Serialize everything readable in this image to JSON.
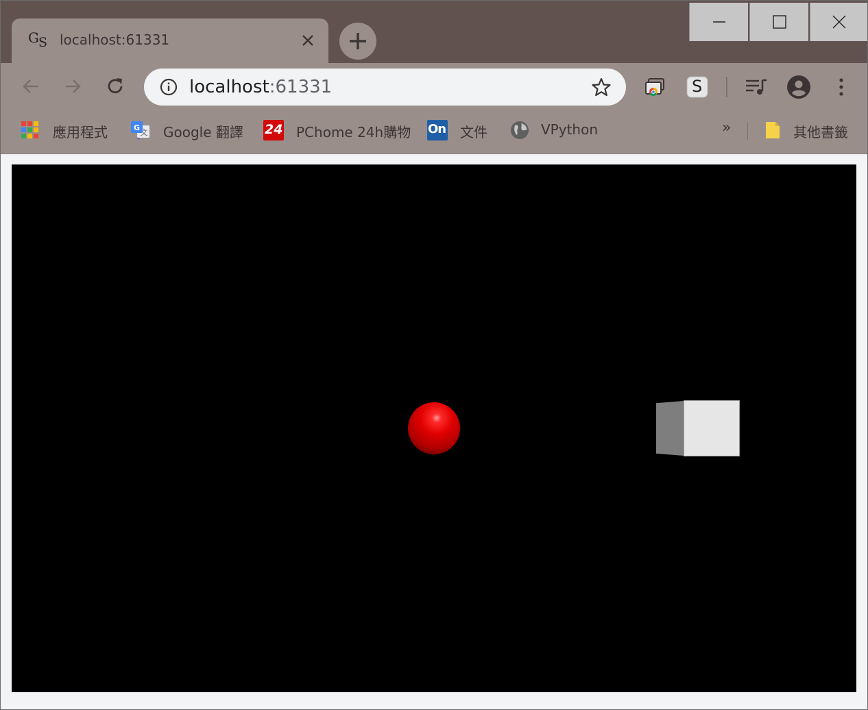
{
  "tab": {
    "favicon_text_g": "G",
    "favicon_text_s": "S",
    "title": "localhost:61331"
  },
  "omnibox": {
    "url_host": "localhost",
    "url_port": ":61331"
  },
  "extensions": {
    "s_badge": "S"
  },
  "bookmarks": {
    "items": [
      {
        "label": "應用程式",
        "icon": "apps-grid-icon"
      },
      {
        "label": "Google 翻譯",
        "icon": "google-translate-icon"
      },
      {
        "label": "PChome 24h購物",
        "icon": "pchome-24-icon",
        "icon_text": "24"
      },
      {
        "label": "文件",
        "icon": "on-docs-icon",
        "icon_text": "On"
      },
      {
        "label": "VPython",
        "icon": "globe-icon"
      }
    ],
    "more": "»",
    "other": {
      "label": "其他書籤",
      "icon": "folder-icon"
    }
  },
  "scene": {
    "background": "#000000",
    "sphere_color": "#e00000",
    "box_color": "#e6e6e6"
  },
  "colors": {
    "titlebar": "#62524f",
    "toolbar": "#9a8e8b",
    "omnibox": "#f1f3f4"
  }
}
